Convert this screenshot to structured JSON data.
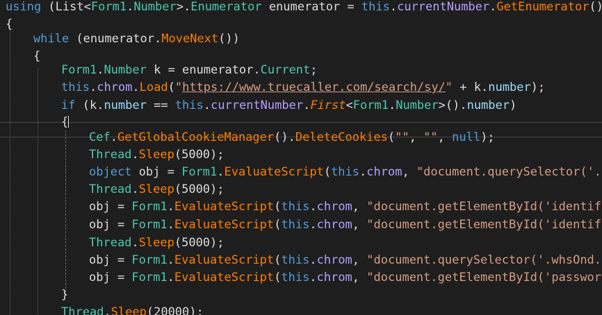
{
  "colors": {
    "background": "#1e1e1e",
    "plain": "#dcdcdc",
    "keyword": "#569cd6",
    "type": "#4ec9b0",
    "method": "#ff8000",
    "property": "#b4a0ff",
    "member": "#9cdcfe",
    "string": "#d69d85",
    "current_line_border": "#464646"
  },
  "editor": {
    "current_line": 7,
    "lines": [
      [
        {
          "t": "using",
          "c": "kw"
        },
        {
          "t": " (",
          "c": "p"
        },
        {
          "t": "List",
          "c": "p"
        },
        {
          "t": "<",
          "c": "p"
        },
        {
          "t": "Form1",
          "c": "ty"
        },
        {
          "t": ".",
          "c": "p"
        },
        {
          "t": "Number",
          "c": "ty"
        },
        {
          "t": ">.",
          "c": "p"
        },
        {
          "t": "Enumerator",
          "c": "ty"
        },
        {
          "t": " enumerator = ",
          "c": "p"
        },
        {
          "t": "this",
          "c": "kw"
        },
        {
          "t": ".",
          "c": "p"
        },
        {
          "t": "currentNumber",
          "c": "pr"
        },
        {
          "t": ".",
          "c": "p"
        },
        {
          "t": "GetEnumerator",
          "c": "fn"
        },
        {
          "t": "())",
          "c": "p"
        }
      ],
      [
        {
          "t": "{",
          "c": "p"
        }
      ],
      [
        {
          "t": "while",
          "c": "kw"
        },
        {
          "t": " (enumerator.",
          "c": "p"
        },
        {
          "t": "MoveNext",
          "c": "fn"
        },
        {
          "t": "())",
          "c": "p"
        }
      ],
      [
        {
          "t": "{",
          "c": "p"
        }
      ],
      [
        {
          "t": "Form1",
          "c": "ty"
        },
        {
          "t": ".",
          "c": "p"
        },
        {
          "t": "Number",
          "c": "ty"
        },
        {
          "t": " k = enumerator.",
          "c": "p"
        },
        {
          "t": "Current",
          "c": "ty"
        },
        {
          "t": ";",
          "c": "p"
        }
      ],
      [
        {
          "t": "this",
          "c": "kw"
        },
        {
          "t": ".",
          "c": "p"
        },
        {
          "t": "chrom",
          "c": "pr"
        },
        {
          "t": ".",
          "c": "p"
        },
        {
          "t": "Load",
          "c": "fn"
        },
        {
          "t": "(",
          "c": "p"
        },
        {
          "t": "\"",
          "c": "st"
        },
        {
          "t": "https://www.truecaller.com/search/sy/",
          "c": "st url"
        },
        {
          "t": "\"",
          "c": "st"
        },
        {
          "t": " + k.",
          "c": "p"
        },
        {
          "t": "number",
          "c": "mb"
        },
        {
          "t": ");",
          "c": "p"
        }
      ],
      [
        {
          "t": "if",
          "c": "kw"
        },
        {
          "t": " (k.",
          "c": "p"
        },
        {
          "t": "number",
          "c": "mb"
        },
        {
          "t": " == ",
          "c": "p"
        },
        {
          "t": "this",
          "c": "kw"
        },
        {
          "t": ".",
          "c": "p"
        },
        {
          "t": "currentNumber",
          "c": "pr"
        },
        {
          "t": ".",
          "c": "p"
        },
        {
          "t": "First",
          "c": "fn it"
        },
        {
          "t": "<",
          "c": "p"
        },
        {
          "t": "Form1",
          "c": "ty"
        },
        {
          "t": ".",
          "c": "p"
        },
        {
          "t": "Number",
          "c": "ty"
        },
        {
          "t": ">().",
          "c": "p"
        },
        {
          "t": "number",
          "c": "mb"
        },
        {
          "t": ")",
          "c": "p"
        }
      ],
      [
        {
          "t": "{",
          "c": "p"
        }
      ],
      [
        {
          "t": "Cef",
          "c": "ty"
        },
        {
          "t": ".",
          "c": "p"
        },
        {
          "t": "GetGlobalCookieManager",
          "c": "fn"
        },
        {
          "t": "().",
          "c": "p"
        },
        {
          "t": "DeleteCookies",
          "c": "fn"
        },
        {
          "t": "(",
          "c": "p"
        },
        {
          "t": "\"\"",
          "c": "st"
        },
        {
          "t": ", ",
          "c": "p"
        },
        {
          "t": "\"\"",
          "c": "st"
        },
        {
          "t": ", ",
          "c": "p"
        },
        {
          "t": "null",
          "c": "kw"
        },
        {
          "t": ");",
          "c": "p"
        }
      ],
      [
        {
          "t": "Thread",
          "c": "ty"
        },
        {
          "t": ".",
          "c": "p"
        },
        {
          "t": "Sleep",
          "c": "fn"
        },
        {
          "t": "(5000);",
          "c": "p"
        }
      ],
      [
        {
          "t": "object",
          "c": "kw"
        },
        {
          "t": " obj = ",
          "c": "p"
        },
        {
          "t": "Form1",
          "c": "ty"
        },
        {
          "t": ".",
          "c": "p"
        },
        {
          "t": "EvaluateScript",
          "c": "fn"
        },
        {
          "t": "(",
          "c": "p"
        },
        {
          "t": "this",
          "c": "kw"
        },
        {
          "t": ".",
          "c": "p"
        },
        {
          "t": "chrom",
          "c": "pr"
        },
        {
          "t": ", ",
          "c": "p"
        },
        {
          "t": "\"document.querySelector('.si",
          "c": "st"
        }
      ],
      [
        {
          "t": "Thread",
          "c": "ty"
        },
        {
          "t": ".",
          "c": "p"
        },
        {
          "t": "Sleep",
          "c": "fn"
        },
        {
          "t": "(5000);",
          "c": "p"
        }
      ],
      [
        {
          "t": "obj = ",
          "c": "p"
        },
        {
          "t": "Form1",
          "c": "ty"
        },
        {
          "t": ".",
          "c": "p"
        },
        {
          "t": "EvaluateScript",
          "c": "fn"
        },
        {
          "t": "(",
          "c": "p"
        },
        {
          "t": "this",
          "c": "kw"
        },
        {
          "t": ".",
          "c": "p"
        },
        {
          "t": "chrom",
          "c": "pr"
        },
        {
          "t": ", ",
          "c": "p"
        },
        {
          "t": "\"document.getElementById('identifie",
          "c": "st"
        }
      ],
      [
        {
          "t": "obj = ",
          "c": "p"
        },
        {
          "t": "Form1",
          "c": "ty"
        },
        {
          "t": ".",
          "c": "p"
        },
        {
          "t": "EvaluateScript",
          "c": "fn"
        },
        {
          "t": "(",
          "c": "p"
        },
        {
          "t": "this",
          "c": "kw"
        },
        {
          "t": ".",
          "c": "p"
        },
        {
          "t": "chrom",
          "c": "pr"
        },
        {
          "t": ", ",
          "c": "p"
        },
        {
          "t": "\"document.getElementById('identifie",
          "c": "st"
        }
      ],
      [
        {
          "t": "Thread",
          "c": "ty"
        },
        {
          "t": ".",
          "c": "p"
        },
        {
          "t": "Sleep",
          "c": "fn"
        },
        {
          "t": "(5000);",
          "c": "p"
        }
      ],
      [
        {
          "t": "obj = ",
          "c": "p"
        },
        {
          "t": "Form1",
          "c": "ty"
        },
        {
          "t": ".",
          "c": "p"
        },
        {
          "t": "EvaluateScript",
          "c": "fn"
        },
        {
          "t": "(",
          "c": "p"
        },
        {
          "t": "this",
          "c": "kw"
        },
        {
          "t": ".",
          "c": "p"
        },
        {
          "t": "chrom",
          "c": "pr"
        },
        {
          "t": ", ",
          "c": "p"
        },
        {
          "t": "\"document.querySelector('.whsOnd.zH",
          "c": "st"
        }
      ],
      [
        {
          "t": "obj = ",
          "c": "p"
        },
        {
          "t": "Form1",
          "c": "ty"
        },
        {
          "t": ".",
          "c": "p"
        },
        {
          "t": "EvaluateScript",
          "c": "fn"
        },
        {
          "t": "(",
          "c": "p"
        },
        {
          "t": "this",
          "c": "kw"
        },
        {
          "t": ".",
          "c": "p"
        },
        {
          "t": "chrom",
          "c": "pr"
        },
        {
          "t": ", ",
          "c": "p"
        },
        {
          "t": "\"document.getElementById('passwordN",
          "c": "st"
        }
      ],
      [
        {
          "t": "}",
          "c": "p"
        }
      ],
      [
        {
          "t": "Thread",
          "c": "ty"
        },
        {
          "t": ".",
          "c": "p"
        },
        {
          "t": "Sleep",
          "c": "fn"
        },
        {
          "t": "(20000);",
          "c": "p"
        }
      ]
    ]
  }
}
